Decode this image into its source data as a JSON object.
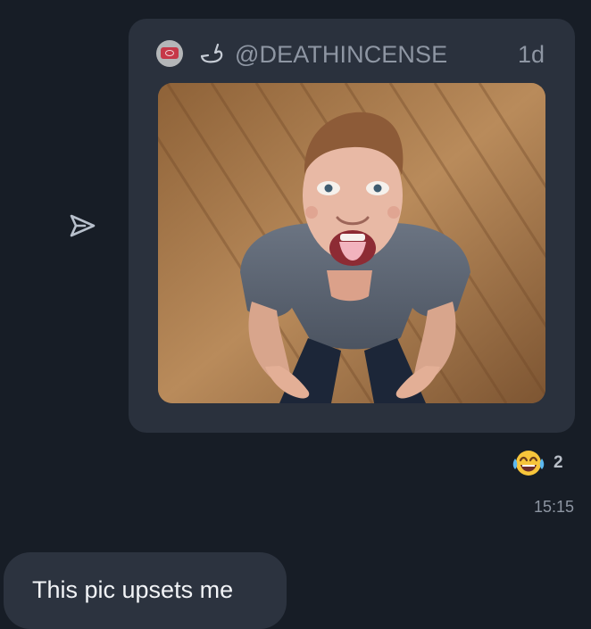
{
  "post": {
    "handle": "@DEATHINCENSE",
    "age": "1d",
    "avatar_icon": "masked-avatar-icon",
    "emoji_icon": "pointing-hand-emoji",
    "image_icon": "shared-photo"
  },
  "reaction": {
    "emoji": "face-with-tears-of-joy-emoji",
    "count": "2"
  },
  "message": {
    "time": "15:15",
    "text": "This pic upsets me"
  },
  "actions": {
    "share_icon": "send-icon"
  },
  "colors": {
    "background": "#171d26",
    "card": "#2a313d",
    "bubble": "#2c333f",
    "muted_text": "#8e96a3",
    "primary_text": "#f2f4f7"
  }
}
